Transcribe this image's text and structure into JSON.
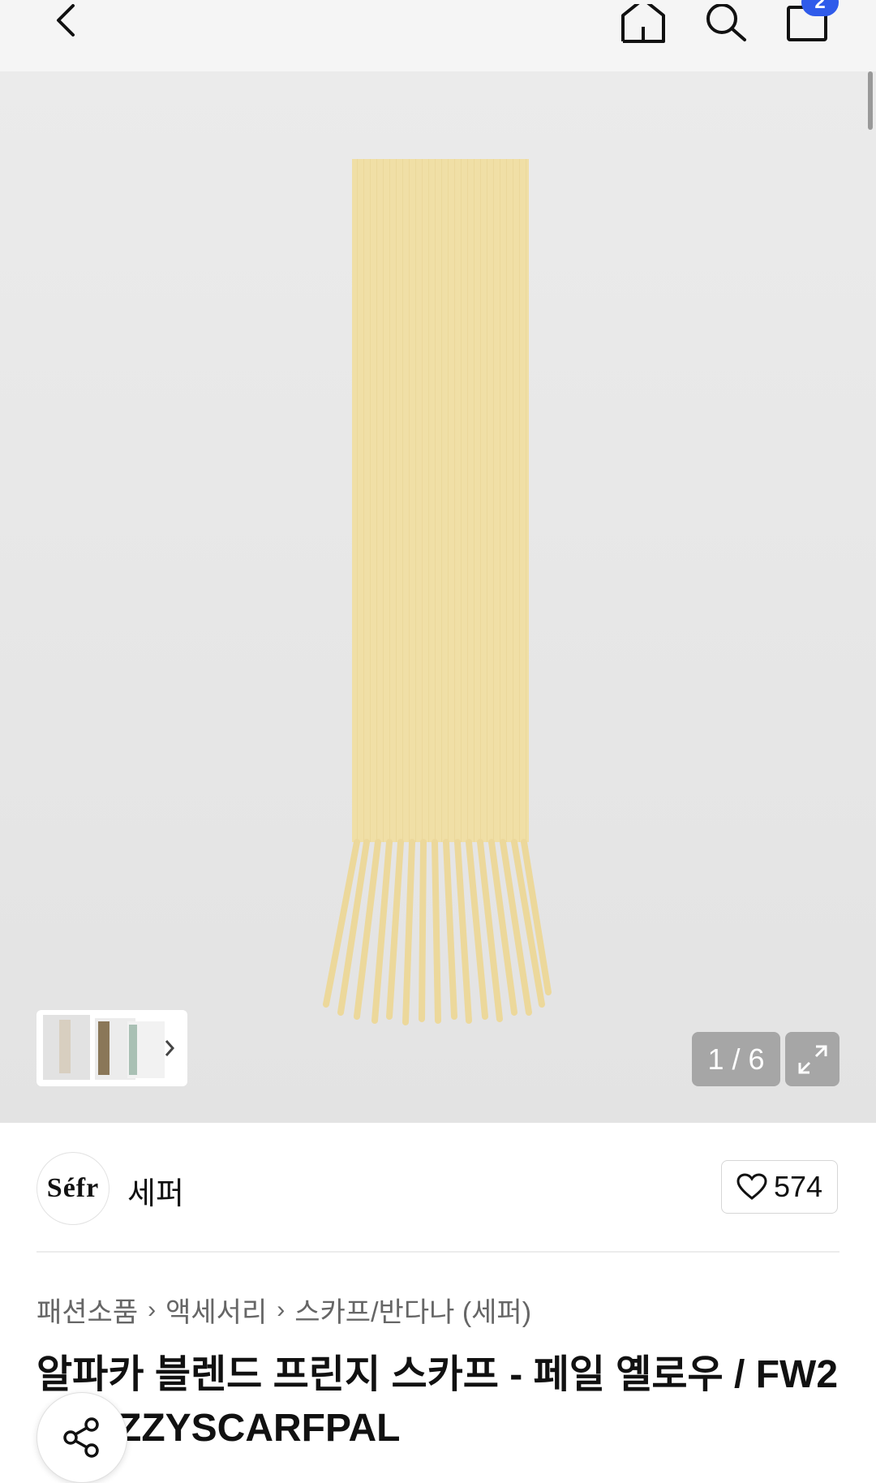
{
  "header": {
    "back_icon": "chevron-left-icon",
    "home_icon": "home-icon",
    "search_icon": "search-icon",
    "cart_icon": "shopping-bag-icon",
    "cart_count": "2",
    "badge_color": "#2f5bea"
  },
  "gallery": {
    "counter": "1 / 6",
    "expand_icon": "expand-icon",
    "product_color": "#f0dfa6"
  },
  "brand": {
    "logo_text": "Séfr",
    "name": "세퍼",
    "likes": "574"
  },
  "breadcrumb": {
    "items": [
      "패션소품",
      "액세서리",
      "스카프/반다나 (세퍼)"
    ]
  },
  "product": {
    "title_line1": "알파카 블렌드 프린지 스카프 - 페일 옐로우 / FW2",
    "title_line2": "ZZYSCARFPAL"
  }
}
